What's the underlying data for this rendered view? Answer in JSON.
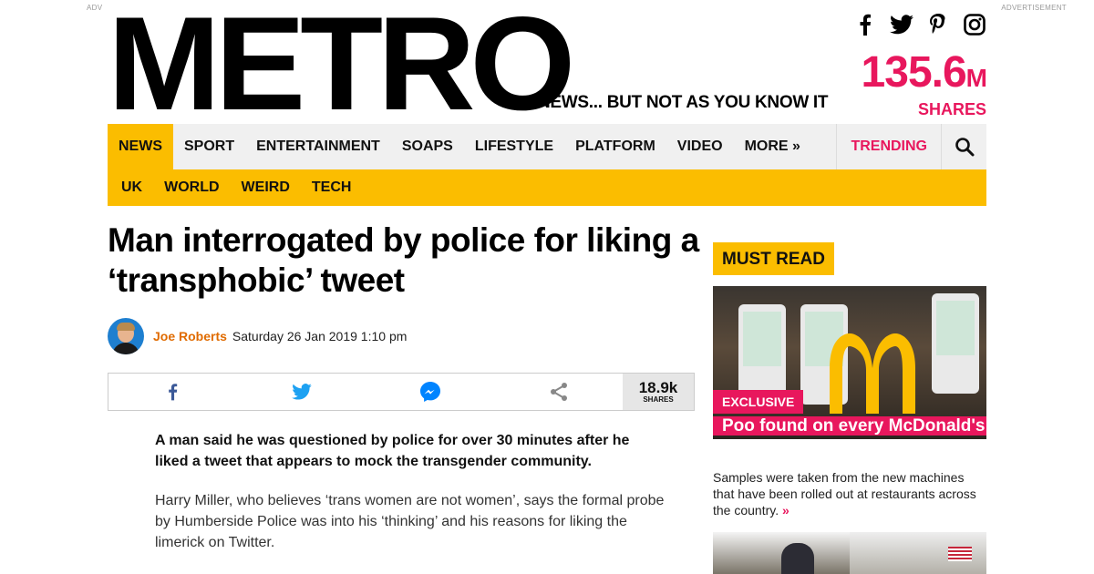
{
  "ads": {
    "left": "ADV",
    "right": "ADVERTISEMENT"
  },
  "header": {
    "logo": "METRO",
    "tagline": "NEWS... BUT NOT AS YOU KNOW IT",
    "shares_number": "135.6",
    "shares_unit": "M",
    "shares_label": "SHARES",
    "social_icons": [
      "facebook-icon",
      "twitter-icon",
      "pinterest-icon",
      "instagram-icon"
    ]
  },
  "nav": {
    "items": [
      "NEWS",
      "SPORT",
      "ENTERTAINMENT",
      "SOAPS",
      "LIFESTYLE",
      "PLATFORM",
      "VIDEO",
      "MORE »"
    ],
    "active": "NEWS",
    "trending": "TRENDING",
    "search_icon": "search-icon"
  },
  "subnav": {
    "items": [
      "UK",
      "WORLD",
      "WEIRD",
      "TECH"
    ]
  },
  "article": {
    "headline": "Man interrogated by police for liking a ‘transphobic’ tweet",
    "author": "Joe Roberts",
    "date": "Saturday 26 Jan 2019 1:10 pm",
    "share_count": "18.9k",
    "share_count_label": "SHARES",
    "share_icons": [
      "facebook-icon",
      "twitter-icon",
      "messenger-icon",
      "share-icon"
    ],
    "lede": "A man said he was questioned by police for over 30 minutes after he liked a tweet that appears to mock the transgender community.",
    "paragraph": "Harry Miller, who believes ‘trans women are not women’, says the formal probe by Humberside Police was into his ‘thinking’ and his reasons for liking the limerick on Twitter."
  },
  "sidebar": {
    "heading": "MUST READ",
    "promo": {
      "badge": "EXCLUSIVE",
      "title": "Poo found on every McDonald's touchscreen tested",
      "description": "Samples were taken from the new machines that have been rolled out at restaurants across the country.",
      "more": "»"
    }
  },
  "colors": {
    "accent_yellow": "#fbbd00",
    "brand_pink": "#e8175d",
    "author_orange": "#e06b00"
  }
}
